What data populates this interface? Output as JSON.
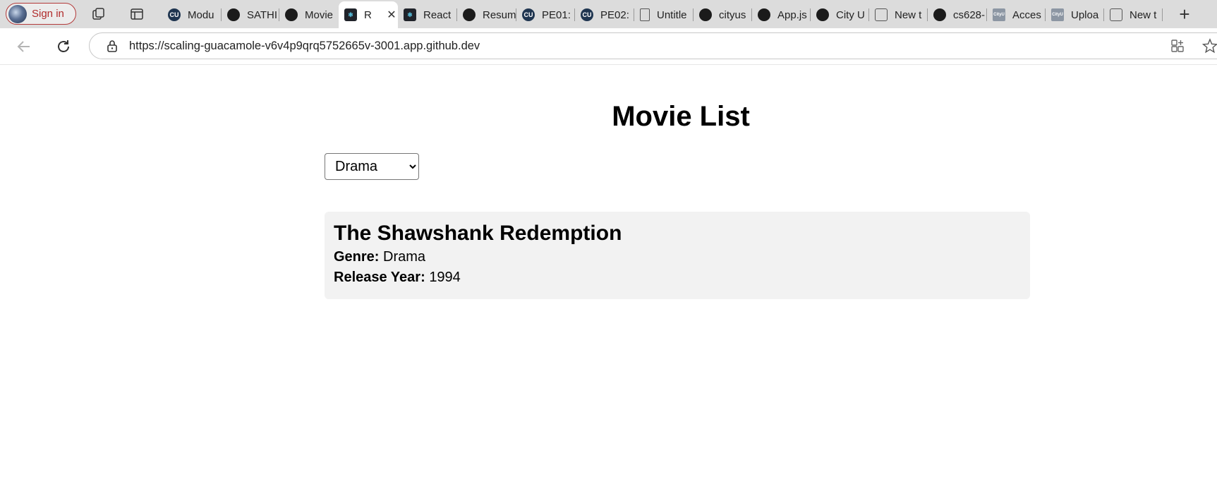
{
  "browser": {
    "signin_label": "Sign in",
    "tabs": [
      {
        "title": "Modu",
        "icon": "cu"
      },
      {
        "title": "SATHI",
        "icon": "github"
      },
      {
        "title": "Movie",
        "icon": "github"
      },
      {
        "title": "R",
        "icon": "react",
        "active": true
      },
      {
        "title": "React",
        "icon": "react"
      },
      {
        "title": "Resum",
        "icon": "github"
      },
      {
        "title": "PE01:",
        "icon": "cu"
      },
      {
        "title": "PE02:",
        "icon": "cu"
      },
      {
        "title": "Untitle",
        "icon": "document"
      },
      {
        "title": "cityus",
        "icon": "github"
      },
      {
        "title": "App.js",
        "icon": "github"
      },
      {
        "title": "City U",
        "icon": "github"
      },
      {
        "title": "New t",
        "icon": "new-tab"
      },
      {
        "title": "cs628-",
        "icon": "github"
      },
      {
        "title": "Acces",
        "icon": "cityu"
      },
      {
        "title": "Uploa",
        "icon": "cityu"
      },
      {
        "title": "New t",
        "icon": "new-tab"
      }
    ],
    "url": "https://scaling-guacamole-v6v4p9qrq5752665v-3001.app.github.dev",
    "cu_label": "CU",
    "react_label": "⚛",
    "cityu_label": "CityU",
    "close_glyph": "✕",
    "newtab_glyph": "+"
  },
  "page": {
    "title": "Movie List",
    "genre_filter": {
      "selected": "Drama"
    },
    "movies": [
      {
        "title": "The Shawshank Redemption",
        "genre_label": "Genre:",
        "genre": "Drama",
        "year_label": "Release Year:",
        "year": "1994"
      }
    ]
  },
  "colors": {
    "tabstrip_bg": "#dcdcdc",
    "signin_accent": "#b02a2a",
    "card_bg": "#f2f2f2"
  }
}
